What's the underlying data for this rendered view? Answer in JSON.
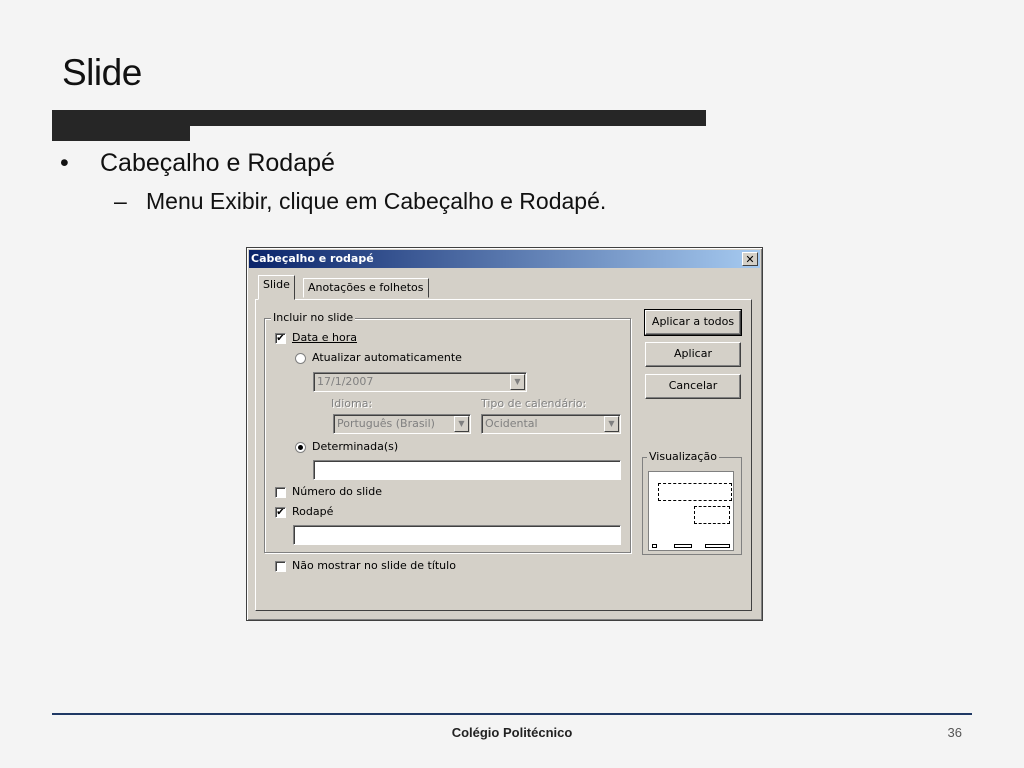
{
  "slide": {
    "title": "Slide",
    "bullet_level1_mark": "•",
    "bullet_level1": "Cabeçalho e Rodapé",
    "bullet_level2_mark": "–",
    "bullet_level2": "Menu Exibir, clique em Cabeçalho e Rodapé.",
    "footer": "Colégio Politécnico",
    "page_number": "36"
  },
  "dialog": {
    "title": "Cabeçalho e rodapé",
    "close_glyph": "✕",
    "tabs": [
      {
        "label": "Slide",
        "active": true
      },
      {
        "label": "Anotações e folhetos",
        "active": false
      }
    ],
    "group_label": "Incluir no slide",
    "date_time": {
      "label": "Data e hora",
      "checked": true
    },
    "auto_update": {
      "label": "Atualizar automaticamente",
      "selected": false
    },
    "date_value": "17/1/2007",
    "language": {
      "label": "Idioma:",
      "value": "Português (Brasil)"
    },
    "calendar": {
      "label": "Tipo de calendário:",
      "value": "Ocidental"
    },
    "fixed": {
      "label": "Determinada(s)",
      "selected": true,
      "value": ""
    },
    "slide_number": {
      "label": "Número do slide",
      "checked": false
    },
    "footer": {
      "label": "Rodapé",
      "checked": true,
      "value": ""
    },
    "hide_on_title": {
      "label": "Não mostrar no slide de título",
      "checked": false
    },
    "buttons": {
      "apply_all": "Aplicar a todos",
      "apply": "Aplicar",
      "cancel": "Cancelar"
    },
    "preview_label": "Visualização",
    "check_glyph": "✔",
    "arrow_glyph": "▼"
  }
}
